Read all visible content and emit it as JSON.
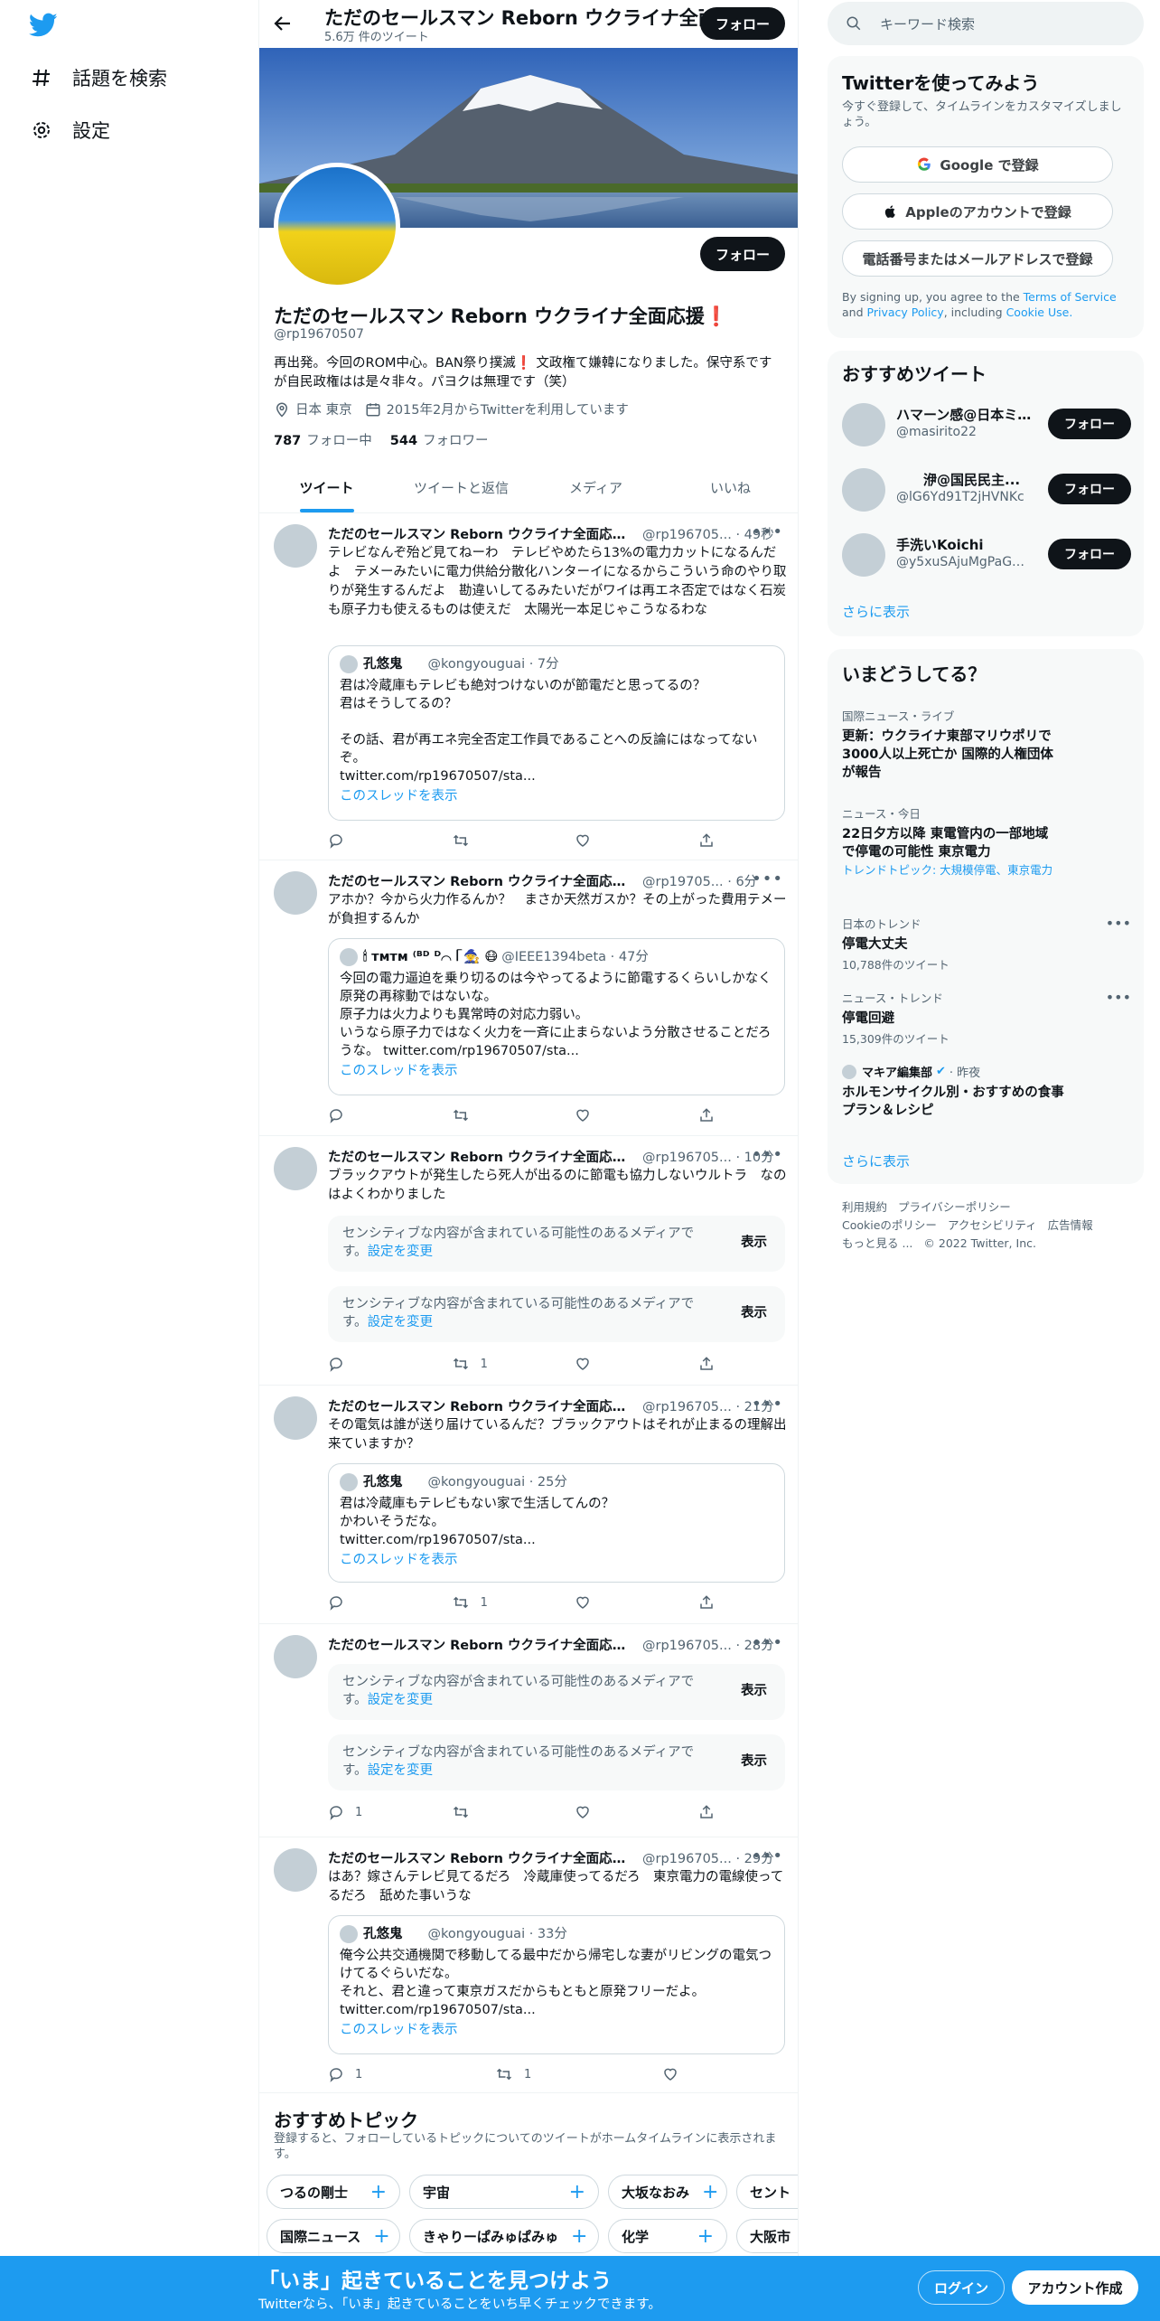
{
  "nav": {
    "explore_label": "話題を検索",
    "settings_label": "設定"
  },
  "profile": {
    "topbar_name": "ただのセールスマン Reborn ウクライナ全面応援❗",
    "tweet_count": "5.6万 件のツイート",
    "follow_label": "フォロー",
    "name": "ただのセールスマン Reborn ウクライナ全面応援❗",
    "handle": "@rp19670507",
    "bio": "再出発。今回のROM中心。BAN祭り撲滅❗ 文政権て嫌韓になりました。保守系ですが自民政権はは是々非々。パヨクは無理です（笑）",
    "location": "日本 東京",
    "joined": "2015年2月からTwitterを利用しています",
    "following_count": "787",
    "following_label": "フォロー中",
    "followers_count": "544",
    "followers_label": "フォロワー"
  },
  "tabs": [
    "ツイート",
    "ツイートと返信",
    "メディア",
    "いいね"
  ],
  "tweets": [
    {
      "name": "ただのセールスマン Reborn ウクライナ全面応援❗",
      "meta": "@rp196705... · 49秒",
      "text": "テレビなんぞ殆ど見てねーわ　テレビやめたら13%の電力カットになるんだよ　テメーみたいに電力供給分散化ハンターイになるからこういう命のやり取りが発生するんだよ　勘違いしてるみたいだがワイは再エネ否定ではなく石炭も原子力も使えるものは使えだ　太陽光一本足じゃこうなるわな",
      "quote": {
        "name": "孔悠鬼",
        "meta": "@kongyouguai · 7分",
        "text": "君は冷蔵庫もテレビも絶対つけないのが節電だと思ってるの？\n君はそうしてるの？\n\nその話、君が再エネ完全否定工作員であることへの反論にはなってないぞ。\ntwitter.com/rp19670507/sta...",
        "link": "このスレッドを表示"
      },
      "reply": "",
      "retweet": "",
      "like": ""
    },
    {
      "name": "ただのセールスマン Reborn ウクライナ全面応援❗",
      "meta": "@rp19705... · 6分",
      "text": "アホか？今から火力作るんか？　まさか天然ガスか？その上がった費用テメーが負担するんか",
      "quote": {
        "name": "🕯 ᴛᴍᴛᴍ ⁽ᴮᴰ ᴰ⌒ ᥬ 🧙 😷",
        "meta": "@IEEE1394beta · 47分",
        "text": "今回の電力逼迫を乗り切るのは今やってるように節電するくらいしかなく原発の再稼動ではないな。\n原子力は火力よりも異常時の対応力弱い。\nいうなら原子力ではなく火力を一斉に止まらないよう分散させることだろうな。 twitter.com/rp19670507/sta...",
        "link": "このスレッドを表示"
      },
      "reply": "",
      "retweet": "",
      "like": ""
    },
    {
      "name": "ただのセールスマン Reborn ウクライナ全面応援❗",
      "meta": "@rp196705... · 10分",
      "text": "ブラックアウトが発生したら死人が出るのに節電も協力しないウルトラ　なのはよくわかりました",
      "sensitive": [
        "センシティブな内容が含まれている可能性のあるメディアです。",
        "センシティブな内容が含まれている可能性のあるメディアです。"
      ],
      "reply": "",
      "retweet": "1",
      "like": ""
    },
    {
      "name": "ただのセールスマン Reborn ウクライナ全面応援❗",
      "meta": "@rp196705... · 21分",
      "text": "その電気は誰が送り届けているんだ？ブラックアウトはそれが止まるの理解出来ていますか？",
      "quote": {
        "name": "孔悠鬼",
        "meta": "@kongyouguai · 25分",
        "text": "君は冷蔵庫もテレビもない家で生活してんの？\nかわいそうだな。\ntwitter.com/rp19670507/sta...",
        "link": "このスレッドを表示"
      },
      "reply": "",
      "retweet": "1",
      "like": ""
    },
    {
      "name": "ただのセールスマン Reborn ウクライナ全面応援❗",
      "meta": "@rp196705... · 28分",
      "text": "",
      "sensitive": [
        "センシティブな内容が含まれている可能性のあるメディアです。",
        "センシティブな内容が含まれている可能性のあるメディアです。"
      ],
      "reply": "1",
      "retweet": "",
      "like": ""
    },
    {
      "name": "ただのセールスマン Reborn ウクライナ全面応援❗",
      "meta": "@rp196705... · 29分",
      "text": "はあ？嫁さんテレビ見てるだろ　冷蔵庫使ってるだろ　東京電力の電線使ってるだろ　舐めた事いうな",
      "quote": {
        "name": "孔悠鬼",
        "meta": "@kongyouguai · 33分",
        "text": "俺今公共交通機関で移動してる最中だから帰宅しな妻がリビングの電気つけてるぐらいだな。\nそれと、君と違って東京ガスだからもともと原発フリーだよ。\ntwitter.com/rp19670507/sta...",
        "link": "このスレッドを表示"
      },
      "reply": "1",
      "retweet": "1",
      "like": ""
    }
  ],
  "sensitive_ui": {
    "settings_link": "設定を変更",
    "show_label": "表示"
  },
  "topics": {
    "title": "おすすめトピック",
    "subtitle": "登録すると、フォローしているトピックについてのツイートがホームタイムラインに表示されます。",
    "row1": [
      "つるの剛士",
      "宇宙",
      "大坂なおみ",
      "セント"
    ],
    "row2": [
      "国際ニュース",
      "きゃりーぱみゅぱみゅ",
      "化学",
      "大阪市"
    ]
  },
  "right": {
    "search_placeholder": "キーワード検索",
    "signup": {
      "title": "Twitterを使ってみよう",
      "subtitle": "今すぐ登録して、タイムラインをカスタマイズしましょう。",
      "google": "Google で登録",
      "apple": "Appleのアカウントで登録",
      "phone": "電話番号またはメールアドレスで登録",
      "terms_prefix": "By signing up, you agree to the",
      "terms_link": "Terms of Service",
      "and": "and",
      "privacy_link": "Privacy Policy",
      "including": ", including",
      "cookie_link": "Cookie Use."
    },
    "recommended": {
      "title": "おすすめツイート",
      "users": [
        {
          "name": "ハマーン感@日本ミ...",
          "handle": "@masirito22"
        },
        {
          "name": "　　洢@国民民主...",
          "handle": "@lG6Yd91T2jHVNKc"
        },
        {
          "name": "手洗いKoichi",
          "handle": "@y5xuSAjuMgPaGMQ"
        }
      ],
      "follow_label": "フォロー",
      "more": "さらに表示"
    },
    "trends": {
      "title": "いまどうしてる？",
      "items": [
        {
          "context": "国際ニュース・ライブ",
          "title": "更新：ウクライナ東部マリウポリで3000人以上死亡か 国際的人権団体が報告",
          "extra": ""
        },
        {
          "context": "ニュース・今日",
          "title": "22日夕方以降 東電管内の一部地域で停電の可能性 東京電力",
          "extra": "トレンドトピック: 大規模停電、東京電力"
        },
        {
          "context": "日本のトレンド",
          "title": "停電大丈夫",
          "extra": "10,788件のツイート"
        },
        {
          "context": "ニュース・トレンド",
          "title": "停電回避",
          "extra": "15,309件のツイート"
        }
      ],
      "article": {
        "source": "マキア編集部",
        "time": "· 昨夜",
        "title": "ホルモンサイクル別・おすすめの食事プラン＆レシピ"
      },
      "more": "さらに表示"
    },
    "footer": [
      "利用規約",
      "プライバシーポリシー",
      "Cookieのポリシー",
      "アクセシビリティ",
      "広告情報",
      "もっと見る ...",
      "© 2022 Twitter, Inc."
    ]
  },
  "bottom": {
    "title": "「いま」起きていることを見つけよう",
    "subtitle": "Twitterなら、「いま」起きていることをいち早くチェックできます。",
    "login": "ログイン",
    "signup": "アカウント作成"
  },
  "colors": {
    "accent": "#1d9bf0",
    "text": "#0f1419",
    "muted": "#536471"
  }
}
